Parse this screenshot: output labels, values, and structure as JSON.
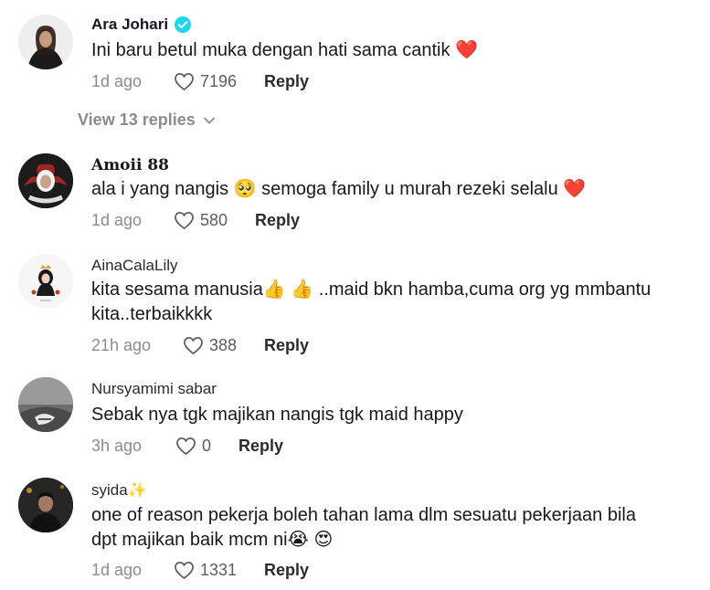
{
  "comments": [
    {
      "username": "Ara Johari",
      "verified": true,
      "text": "Ini baru betul muka dengan hati sama cantik ❤️",
      "time": "1d ago",
      "likes": "7196",
      "reply_label": "Reply",
      "view_replies": "View 13 replies"
    },
    {
      "username": "Amoii 88",
      "text": "ala i yang nangis 🥺 semoga family u murah rezeki selalu ❤️",
      "time": "1d ago",
      "likes": "580",
      "reply_label": "Reply"
    },
    {
      "username": "AinaCalaLily",
      "text_line1": "kita sesama manusia👍 👍 ..maid bkn hamba,cuma org yg mmbantu",
      "text_line2": "kita..terbaikkkk",
      "time": "21h ago",
      "likes": "388",
      "reply_label": "Reply"
    },
    {
      "username": "Nursyamimi sabar",
      "text": "Sebak nya tgk majikan nangis tgk maid happy",
      "time": "3h ago",
      "likes": "0",
      "reply_label": "Reply"
    },
    {
      "username": "syida✨",
      "text_line1": "one of reason pekerja boleh tahan lama dlm sesuatu pekerjaan bila",
      "text_line2": "dpt majikan baik mcm ni😭 😍",
      "time": "1d ago",
      "likes": "1331",
      "reply_label": "Reply"
    }
  ],
  "icons": {
    "verified": "verified-badge-icon",
    "like": "heart-outline-icon",
    "chevron": "chevron-down-icon"
  },
  "colors": {
    "verified": "#20d5ec",
    "muted": "#8a8b91",
    "text": "#161823"
  }
}
